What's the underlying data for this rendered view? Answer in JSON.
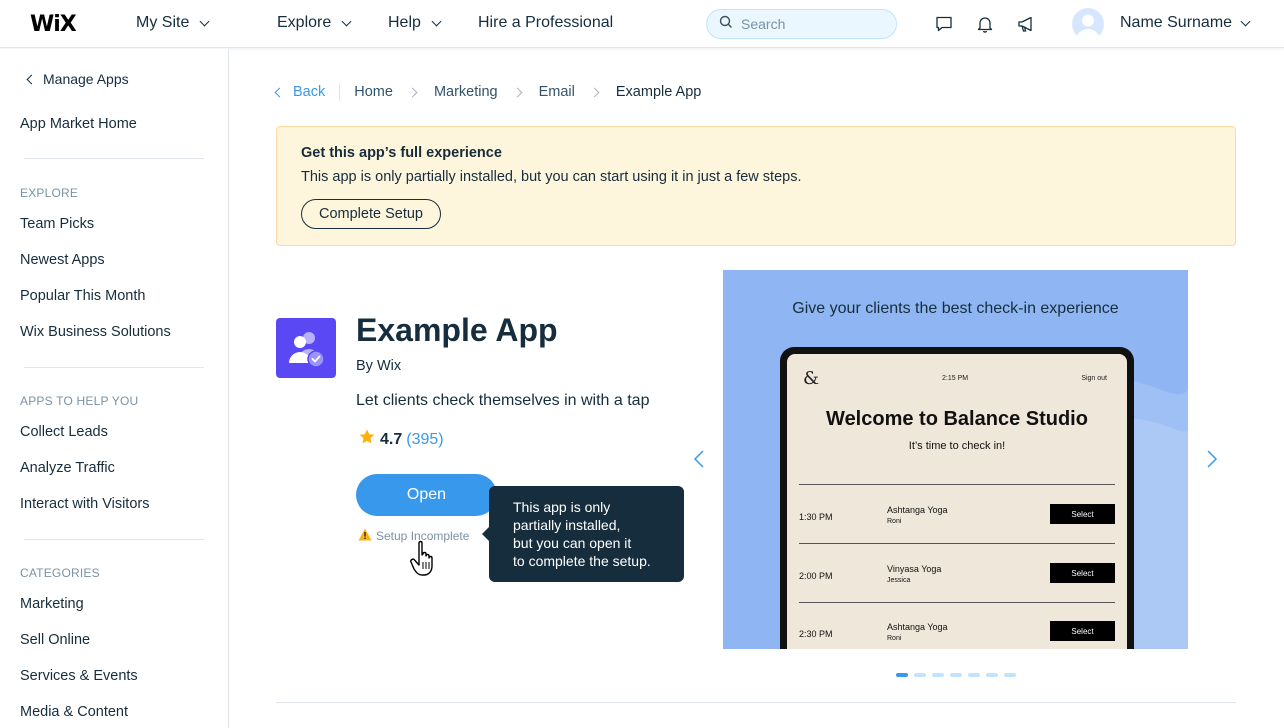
{
  "topbar": {
    "logo": "WiX",
    "my_site": "My Site",
    "explore": "Explore",
    "help": "Help",
    "hire": "Hire a Professional",
    "search_placeholder": "Search",
    "user_name": "Name Surname",
    "icons": [
      "chat-icon",
      "bell-icon",
      "megaphone-icon"
    ]
  },
  "sidebar": {
    "back": "Manage Apps",
    "home": "App Market Home",
    "explore_header": "EXPLORE",
    "explore_items": [
      "Team Picks",
      "Newest Apps",
      "Popular This Month",
      "Wix Business Solutions"
    ],
    "help_header": "APPS TO HELP YOU",
    "help_items": [
      "Collect Leads",
      "Analyze Traffic",
      "Interact with Visitors"
    ],
    "categories_header": "CATEGORIES",
    "categories_items": [
      "Marketing",
      "Sell Online",
      "Services & Events",
      "Media & Content"
    ]
  },
  "breadcrumb": {
    "back": "Back",
    "items": [
      "Home",
      "Marketing",
      "Email"
    ],
    "current": "Example App"
  },
  "banner": {
    "title": "Get this app’s full experience",
    "text": "This app is only partially installed, but you can start using it in just a few steps.",
    "button": "Complete Setup"
  },
  "app": {
    "name": "Example App",
    "by": "By Wix",
    "tagline": "Let clients check themselves in with a tap",
    "rating": "4.7",
    "reviews": "(395)",
    "open_button": "Open",
    "setup_status": "Setup Incomplete",
    "tooltip_lines": [
      "This app is only",
      "partially installed,",
      "but you can open it",
      "to complete the setup."
    ]
  },
  "media": {
    "headline": "Give your clients the best check-in experience",
    "screen": {
      "logo": "&",
      "time": "2:15 PM",
      "signout": "Sign out",
      "welcome": "Welcome to Balance Studio",
      "subtitle": "It’s time to check in!",
      "rows": [
        {
          "time": "1:30 PM",
          "class": "Ashtanga Yoga",
          "instructor": "Roni",
          "button": "Select"
        },
        {
          "time": "2:00 PM",
          "class": "Vinyasa Yoga",
          "instructor": "Jessica",
          "button": "Select"
        },
        {
          "time": "2:30 PM",
          "class": "Ashtanga Yoga",
          "instructor": "Roni",
          "button": "Select"
        }
      ]
    },
    "slide_count": 7,
    "active_slide": 1
  },
  "colors": {
    "accent": "#3899ec",
    "text": "#162d3d",
    "banner_bg": "#fef5dd",
    "app_icon_bg": "#5a48f5",
    "tooltip_bg": "#162d3d",
    "media_bg": "#8fb6f2"
  }
}
